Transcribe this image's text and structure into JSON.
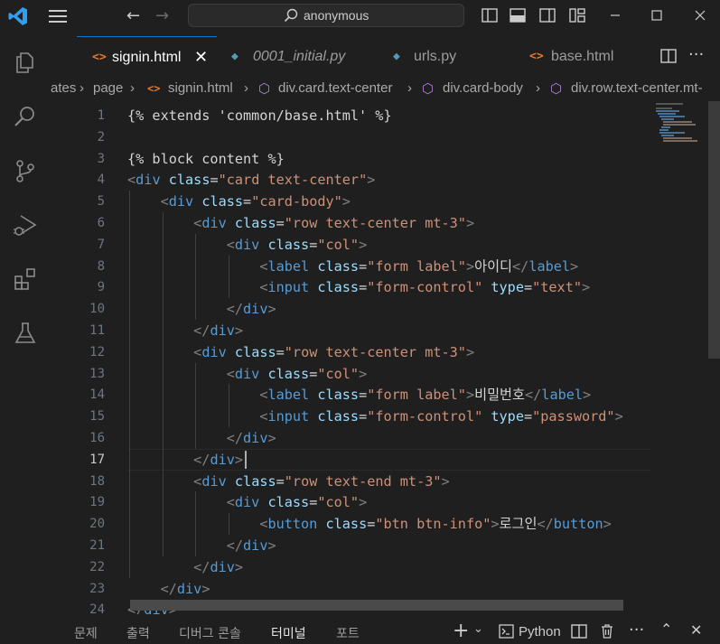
{
  "titlebar": {
    "search_text": "anonymous",
    "icons": [
      "vscode-logo-icon",
      "menu-icon",
      "back-arrow-icon",
      "forward-arrow-icon",
      "search-icon",
      "toggle-sidebar-icon",
      "toggle-panel-icon",
      "toggle-secondary-sidebar-icon",
      "customize-layout-icon",
      "minimize-icon",
      "maximize-icon",
      "close-icon"
    ]
  },
  "activity_bar": {
    "items": [
      "explorer-icon",
      "search-icon",
      "source-control-icon",
      "run-debug-icon",
      "extensions-icon",
      "testing-icon"
    ]
  },
  "tabs": [
    {
      "label": "signin.html",
      "icon": "<>",
      "active": true,
      "italic": false
    },
    {
      "label": "0001_initial.py",
      "icon": "py",
      "active": false,
      "italic": true
    },
    {
      "label": "urls.py",
      "icon": "py",
      "active": false,
      "italic": false
    },
    {
      "label": "base.html",
      "icon": "<>",
      "active": false,
      "italic": false
    }
  ],
  "tab_actions": [
    "split-editor-icon",
    "more-actions-icon"
  ],
  "breadcrumb": [
    "ates",
    "page",
    "signin.html",
    "div.card.text-center",
    "div.card-body",
    "div.row.text-center.mt-"
  ],
  "editor": {
    "current_line": 17,
    "lines": [
      {
        "n": "1",
        "tokens": [
          [
            "tpl",
            "{% extends 'common/base.html' %}"
          ]
        ]
      },
      {
        "n": "2",
        "tokens": []
      },
      {
        "n": "3",
        "tokens": [
          [
            "tpl",
            "{% block content %}"
          ]
        ]
      },
      {
        "n": "4",
        "tokens": [
          [
            "br",
            "<"
          ],
          [
            "tag",
            "div"
          ],
          [
            "txt",
            " "
          ],
          [
            "attr",
            "class"
          ],
          [
            "txt",
            "="
          ],
          [
            "str",
            "\"card text-center\""
          ],
          [
            "br",
            ">"
          ]
        ]
      },
      {
        "n": "5",
        "tokens": [
          [
            "txt",
            "    "
          ],
          [
            "br",
            "<"
          ],
          [
            "tag",
            "div"
          ],
          [
            "txt",
            " "
          ],
          [
            "attr",
            "class"
          ],
          [
            "txt",
            "="
          ],
          [
            "str",
            "\"card-body\""
          ],
          [
            "br",
            ">"
          ]
        ]
      },
      {
        "n": "6",
        "tokens": [
          [
            "txt",
            "        "
          ],
          [
            "br",
            "<"
          ],
          [
            "tag",
            "div"
          ],
          [
            "txt",
            " "
          ],
          [
            "attr",
            "class"
          ],
          [
            "txt",
            "="
          ],
          [
            "str",
            "\"row text-center mt-3\""
          ],
          [
            "br",
            ">"
          ]
        ]
      },
      {
        "n": "7",
        "tokens": [
          [
            "txt",
            "            "
          ],
          [
            "br",
            "<"
          ],
          [
            "tag",
            "div"
          ],
          [
            "txt",
            " "
          ],
          [
            "attr",
            "class"
          ],
          [
            "txt",
            "="
          ],
          [
            "str",
            "\"col\""
          ],
          [
            "br",
            ">"
          ]
        ]
      },
      {
        "n": "8",
        "tokens": [
          [
            "txt",
            "                "
          ],
          [
            "br",
            "<"
          ],
          [
            "tag",
            "label"
          ],
          [
            "txt",
            " "
          ],
          [
            "attr",
            "class"
          ],
          [
            "txt",
            "="
          ],
          [
            "str",
            "\"form label\""
          ],
          [
            "br",
            ">"
          ],
          [
            "txt",
            "아이디"
          ],
          [
            "br",
            "</"
          ],
          [
            "tag",
            "label"
          ],
          [
            "br",
            ">"
          ]
        ]
      },
      {
        "n": "9",
        "tokens": [
          [
            "txt",
            "                "
          ],
          [
            "br",
            "<"
          ],
          [
            "tag",
            "input"
          ],
          [
            "txt",
            " "
          ],
          [
            "attr",
            "class"
          ],
          [
            "txt",
            "="
          ],
          [
            "str",
            "\"form-control\""
          ],
          [
            "txt",
            " "
          ],
          [
            "attr",
            "type"
          ],
          [
            "txt",
            "="
          ],
          [
            "str",
            "\"text\""
          ],
          [
            "br",
            ">"
          ]
        ]
      },
      {
        "n": "10",
        "tokens": [
          [
            "txt",
            "            "
          ],
          [
            "br",
            "</"
          ],
          [
            "tag",
            "div"
          ],
          [
            "br",
            ">"
          ]
        ]
      },
      {
        "n": "11",
        "tokens": [
          [
            "txt",
            "        "
          ],
          [
            "br",
            "</"
          ],
          [
            "tag",
            "div"
          ],
          [
            "br",
            ">"
          ]
        ]
      },
      {
        "n": "12",
        "tokens": [
          [
            "txt",
            "        "
          ],
          [
            "br",
            "<"
          ],
          [
            "tag",
            "div"
          ],
          [
            "txt",
            " "
          ],
          [
            "attr",
            "class"
          ],
          [
            "txt",
            "="
          ],
          [
            "str",
            "\"row text-center mt-3\""
          ],
          [
            "br",
            ">"
          ]
        ]
      },
      {
        "n": "13",
        "tokens": [
          [
            "txt",
            "            "
          ],
          [
            "br",
            "<"
          ],
          [
            "tag",
            "div"
          ],
          [
            "txt",
            " "
          ],
          [
            "attr",
            "class"
          ],
          [
            "txt",
            "="
          ],
          [
            "str",
            "\"col\""
          ],
          [
            "br",
            ">"
          ]
        ]
      },
      {
        "n": "14",
        "tokens": [
          [
            "txt",
            "                "
          ],
          [
            "br",
            "<"
          ],
          [
            "tag",
            "label"
          ],
          [
            "txt",
            " "
          ],
          [
            "attr",
            "class"
          ],
          [
            "txt",
            "="
          ],
          [
            "str",
            "\"form label\""
          ],
          [
            "br",
            ">"
          ],
          [
            "txt",
            "비밀번호"
          ],
          [
            "br",
            "</"
          ],
          [
            "tag",
            "label"
          ],
          [
            "br",
            ">"
          ]
        ]
      },
      {
        "n": "15",
        "tokens": [
          [
            "txt",
            "                "
          ],
          [
            "br",
            "<"
          ],
          [
            "tag",
            "input"
          ],
          [
            "txt",
            " "
          ],
          [
            "attr",
            "class"
          ],
          [
            "txt",
            "="
          ],
          [
            "str",
            "\"form-control\""
          ],
          [
            "txt",
            " "
          ],
          [
            "attr",
            "type"
          ],
          [
            "txt",
            "="
          ],
          [
            "str",
            "\"password\""
          ],
          [
            "br",
            ">"
          ]
        ]
      },
      {
        "n": "16",
        "tokens": [
          [
            "txt",
            "            "
          ],
          [
            "br",
            "</"
          ],
          [
            "tag",
            "div"
          ],
          [
            "br",
            ">"
          ]
        ]
      },
      {
        "n": "17",
        "tokens": [
          [
            "txt",
            "        "
          ],
          [
            "br",
            "</"
          ],
          [
            "tag",
            "div"
          ],
          [
            "br",
            ">"
          ]
        ]
      },
      {
        "n": "18",
        "tokens": [
          [
            "txt",
            "        "
          ],
          [
            "br",
            "<"
          ],
          [
            "tag",
            "div"
          ],
          [
            "txt",
            " "
          ],
          [
            "attr",
            "class"
          ],
          [
            "txt",
            "="
          ],
          [
            "str",
            "\"row text-end mt-3\""
          ],
          [
            "br",
            ">"
          ]
        ]
      },
      {
        "n": "19",
        "tokens": [
          [
            "txt",
            "            "
          ],
          [
            "br",
            "<"
          ],
          [
            "tag",
            "div"
          ],
          [
            "txt",
            " "
          ],
          [
            "attr",
            "class"
          ],
          [
            "txt",
            "="
          ],
          [
            "str",
            "\"col\""
          ],
          [
            "br",
            ">"
          ]
        ]
      },
      {
        "n": "20",
        "tokens": [
          [
            "txt",
            "                "
          ],
          [
            "br",
            "<"
          ],
          [
            "tag",
            "button"
          ],
          [
            "txt",
            " "
          ],
          [
            "attr",
            "class"
          ],
          [
            "txt",
            "="
          ],
          [
            "str",
            "\"btn btn-info\""
          ],
          [
            "br",
            ">"
          ],
          [
            "txt",
            "로그인"
          ],
          [
            "br",
            "</"
          ],
          [
            "tag",
            "button"
          ],
          [
            "br",
            ">"
          ]
        ]
      },
      {
        "n": "21",
        "tokens": [
          [
            "txt",
            "            "
          ],
          [
            "br",
            "</"
          ],
          [
            "tag",
            "div"
          ],
          [
            "br",
            ">"
          ]
        ]
      },
      {
        "n": "22",
        "tokens": [
          [
            "txt",
            "        "
          ],
          [
            "br",
            "</"
          ],
          [
            "tag",
            "div"
          ],
          [
            "br",
            ">"
          ]
        ]
      },
      {
        "n": "23",
        "tokens": [
          [
            "txt",
            "    "
          ],
          [
            "br",
            "</"
          ],
          [
            "tag",
            "div"
          ],
          [
            "br",
            ">"
          ]
        ]
      },
      {
        "n": "24",
        "tokens": [
          [
            "br",
            "</"
          ],
          [
            "tag",
            "div"
          ],
          [
            "br",
            ">"
          ]
        ]
      }
    ]
  },
  "panel": {
    "tabs": [
      "문제",
      "출력",
      "디버그 콘솔",
      "터미널",
      "포트"
    ],
    "active_tab": "터미널",
    "terminal_label": "Python",
    "actions": [
      "add-terminal-icon",
      "chevron-down-icon",
      "terminal-icon",
      "split-terminal-icon",
      "trash-icon",
      "more-icon",
      "maximize-panel-icon",
      "close-panel-icon"
    ]
  },
  "colors": {
    "background": "#1f1f1f",
    "tag": "#569cd6",
    "attr": "#9cdcfe",
    "string": "#ce9178",
    "accent": "#0078d4"
  }
}
